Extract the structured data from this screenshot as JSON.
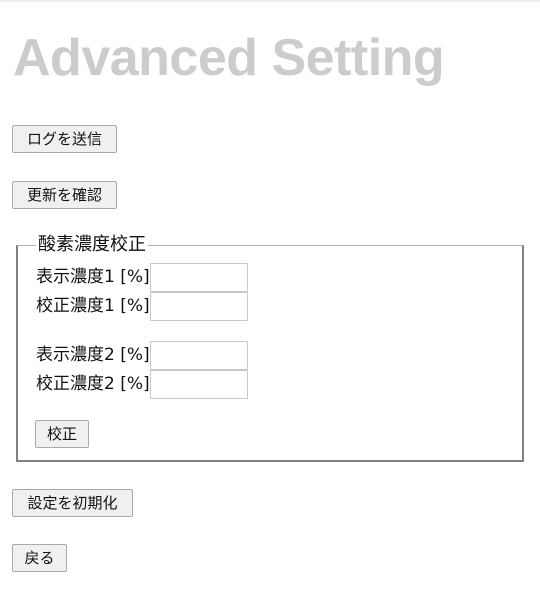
{
  "page": {
    "title": "Advanced Setting"
  },
  "actions": {
    "send_log_label": "ログを送信",
    "check_update_label": "更新を確認",
    "reset_settings_label": "設定を初期化",
    "back_label": "戻る"
  },
  "calibration": {
    "legend": "酸素濃度校正",
    "fields": [
      {
        "label": "表示濃度1 [%]",
        "value": ""
      },
      {
        "label": "校正濃度1 [%]",
        "value": ""
      },
      {
        "label": "表示濃度2 [%]",
        "value": ""
      },
      {
        "label": "校正濃度2 [%]",
        "value": ""
      }
    ],
    "calibrate_label": "校正"
  }
}
